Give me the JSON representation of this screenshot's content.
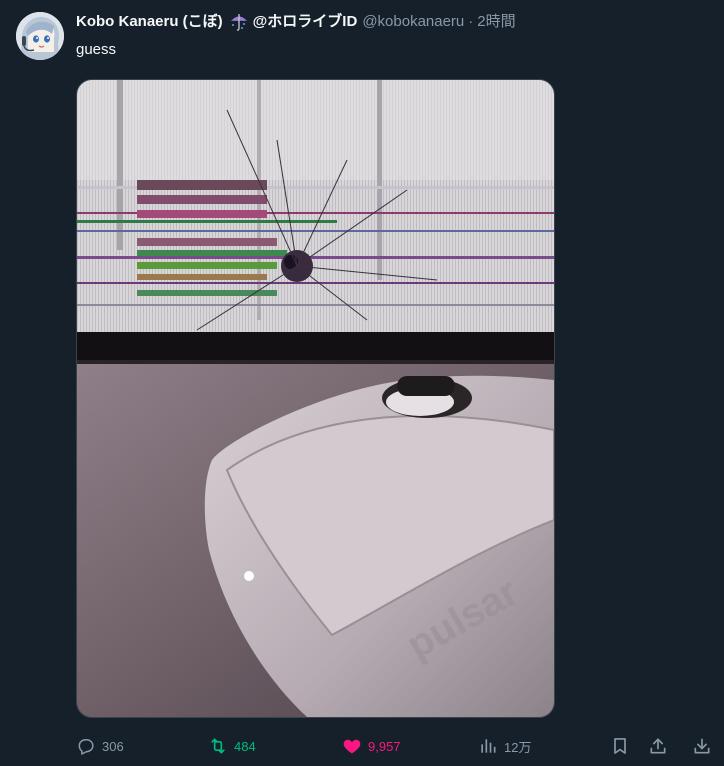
{
  "tweet": {
    "display_name": "Kobo Kanaeru (こぼ)",
    "name_emoji": "umbrella-icon",
    "affiliation": "@ホロライブID",
    "handle": "@kobokanaeru",
    "separator": "·",
    "time": "2時間",
    "text": "guess"
  },
  "media": {
    "description_icon": "photo"
  },
  "actions": {
    "reply_count": "306",
    "retweet_count": "484",
    "like_count": "9,957",
    "view_count": "12万"
  },
  "colors": {
    "background": "#15202b",
    "text_primary": "#f7f9f9",
    "text_secondary": "#8b98a5",
    "retweet_active": "#00ba7c",
    "like_active": "#f91880"
  }
}
